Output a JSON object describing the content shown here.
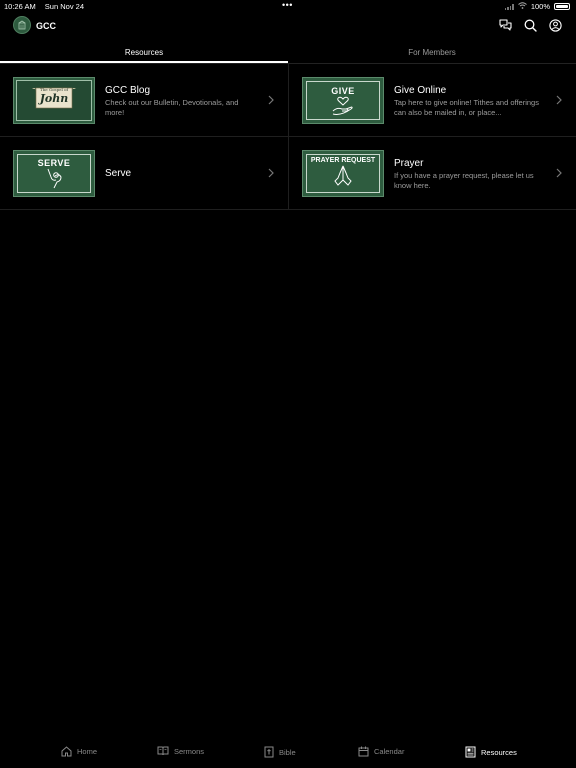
{
  "status_bar": {
    "time": "10:26 AM",
    "date": "Sun Nov 24",
    "battery": "100%"
  },
  "header": {
    "title": "GCC",
    "icons": [
      "chat-icon",
      "search-icon",
      "profile-icon"
    ]
  },
  "tabs": [
    {
      "label": "Resources",
      "active": true
    },
    {
      "label": "For Members",
      "active": false
    }
  ],
  "resources": [
    {
      "title": "GCC Blog",
      "description": "Check out our Bulletin, Devotionals, and more!",
      "thumbnail_text": "John",
      "thumbnail_caption": "The Gospel of"
    },
    {
      "title": "Give Online",
      "description": "Tap here to give online! Tithes and offerings can also be mailed in, or place...",
      "thumbnail_text": "GIVE"
    },
    {
      "title": "Serve",
      "description": "",
      "thumbnail_text": "SERVE"
    },
    {
      "title": "Prayer",
      "description": "If you have a prayer request, please let us know here.",
      "thumbnail_text": "PRAYER REQUEST"
    }
  ],
  "bottom_nav": [
    {
      "label": "Home",
      "icon": "home-icon",
      "active": false
    },
    {
      "label": "Sermons",
      "icon": "book-open-icon",
      "active": false
    },
    {
      "label": "Bible",
      "icon": "bible-icon",
      "active": false
    },
    {
      "label": "Calendar",
      "icon": "calendar-icon",
      "active": false
    },
    {
      "label": "Resources",
      "icon": "newspaper-icon",
      "active": true
    }
  ],
  "colors": {
    "background": "#000000",
    "thumbnail_green": "#2e5c3f",
    "muted_text": "#9c9c9c"
  }
}
